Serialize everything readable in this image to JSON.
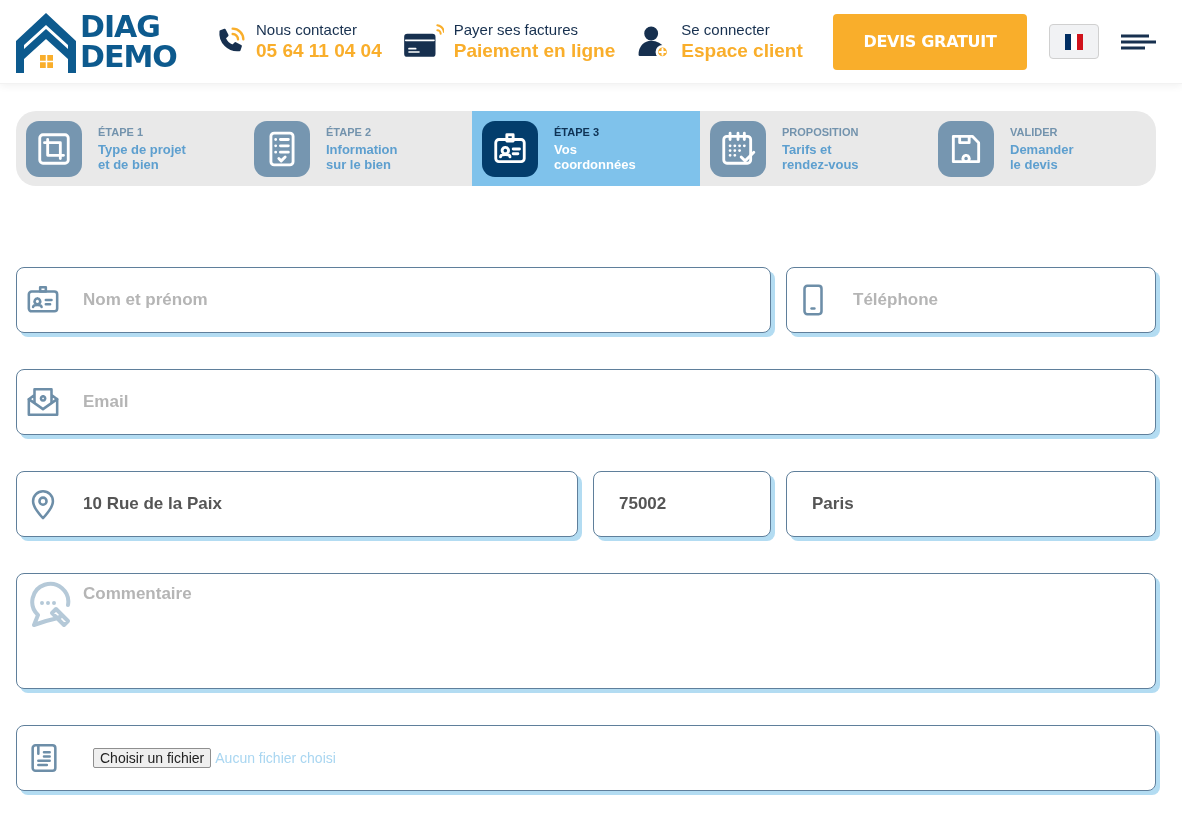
{
  "logo": {
    "line_1": "DIAG",
    "line_2": "DEMO"
  },
  "header_links": [
    {
      "kind": "phone",
      "label": "Nous contacter",
      "value": "05 64 11 04 04"
    },
    {
      "kind": "card",
      "label": "Payer ses factures",
      "value": "Paiement en ligne"
    },
    {
      "kind": "user",
      "label": "Se connecter",
      "value": "Espace client"
    }
  ],
  "cta": "DEVIS GRATUIT",
  "steps": [
    {
      "kind": "plan",
      "label": "ÉTAPE 1",
      "title": "Type de projet\net de bien",
      "selected": false
    },
    {
      "kind": "checklist",
      "label": "ÉTAPE 2",
      "title": "Information\nsur le bien",
      "selected": false
    },
    {
      "kind": "badge",
      "label": "ÉTAPE 3",
      "title": "Vos\ncoordonnées",
      "selected": true
    },
    {
      "kind": "calendar",
      "label": "PROPOSITION",
      "title": "Tarifs et\nrendez-vous",
      "selected": false
    },
    {
      "kind": "save",
      "label": "VALIDER",
      "title": "Demander\nle devis",
      "selected": false
    }
  ],
  "form": {
    "name": {
      "placeholder": "Nom et prénom"
    },
    "phone": {
      "placeholder": "Téléphone"
    },
    "email": {
      "placeholder": "Email"
    },
    "street": {
      "value": "10 Rue de la Paix"
    },
    "postcode": {
      "value": "75002"
    },
    "city": {
      "value": "Paris"
    },
    "comment": {
      "placeholder": "Commentaire"
    },
    "file": {
      "button": "Choisir un fichier",
      "status": "Aucun fichier choisi"
    }
  }
}
